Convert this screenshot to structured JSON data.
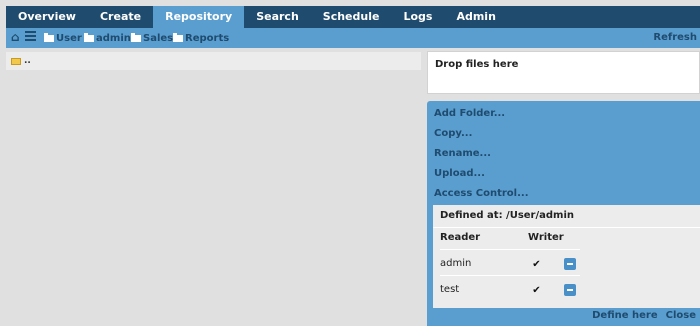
{
  "nav": {
    "tabs": [
      "Overview",
      "Create",
      "Repository",
      "Search",
      "Schedule",
      "Logs",
      "Admin"
    ],
    "active": "Repository"
  },
  "breadcrumb": {
    "home_icon": "home-icon",
    "list_icon": "list-icon",
    "items": [
      "User",
      "admin",
      "Sales",
      "Reports"
    ],
    "refresh_label": "Refresh"
  },
  "files": {
    "rows": [
      ".."
    ]
  },
  "dropzone": {
    "label": "Drop files here"
  },
  "actions": [
    "Add Folder...",
    "Copy...",
    "Rename...",
    "Upload...",
    "Access Control..."
  ],
  "acl": {
    "defined_at": "Defined at: /User/admin",
    "headers": [
      "Reader",
      "Writer"
    ],
    "rows": [
      {
        "name": "admin",
        "writer": true
      },
      {
        "name": "test",
        "writer": true
      }
    ],
    "footer": [
      "Define here",
      "Close"
    ]
  },
  "colors": {
    "nav_bg": "#1f4b6e",
    "accent": "#5a9ed0"
  }
}
